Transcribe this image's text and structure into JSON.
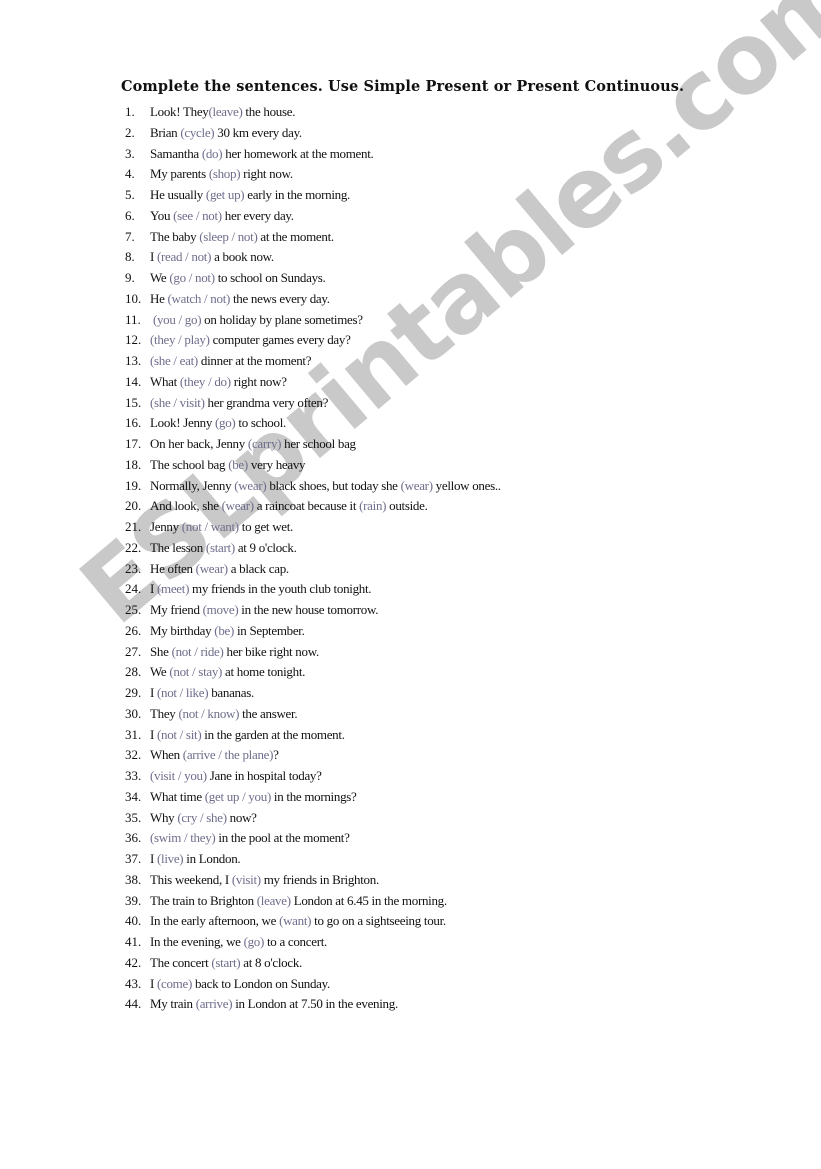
{
  "worksheet": {
    "title": "Complete the sentences. Use Simple Present or Present Continuous.",
    "watermark": "ESLprintables.com",
    "colors": {
      "text": "#111111",
      "hint": "#6e6e8c",
      "watermark": "#c9c9c9"
    },
    "items": [
      {
        "num": "1.",
        "parts": [
          {
            "t": "Look! They"
          },
          {
            "h": "(leave)"
          },
          {
            "t": " the house."
          }
        ]
      },
      {
        "num": "2.",
        "parts": [
          {
            "t": "Brian "
          },
          {
            "h": "(cycle)"
          },
          {
            "t": " 30 km every day."
          }
        ]
      },
      {
        "num": "3.",
        "parts": [
          {
            "t": "Samantha "
          },
          {
            "h": "(do)"
          },
          {
            "t": " her homework at the moment."
          }
        ]
      },
      {
        "num": "4.",
        "parts": [
          {
            "t": "My parents "
          },
          {
            "h": "(shop)"
          },
          {
            "t": " right now."
          }
        ]
      },
      {
        "num": "5.",
        "parts": [
          {
            "t": "He usually "
          },
          {
            "h": "(get up)"
          },
          {
            "t": " early in the morning."
          }
        ]
      },
      {
        "num": "6.",
        "parts": [
          {
            "t": "You "
          },
          {
            "h": "(see / not)"
          },
          {
            "t": " her every day."
          }
        ]
      },
      {
        "num": "7.",
        "parts": [
          {
            "t": "The baby "
          },
          {
            "h": "(sleep / not)"
          },
          {
            "t": " at the moment."
          }
        ]
      },
      {
        "num": "8.",
        "parts": [
          {
            "t": "I "
          },
          {
            "h": "(read / not)"
          },
          {
            "t": " a book now."
          }
        ]
      },
      {
        "num": "9.",
        "parts": [
          {
            "t": "We "
          },
          {
            "h": "(go / not)"
          },
          {
            "t": " to school on Sundays."
          }
        ]
      },
      {
        "num": "10.",
        "parts": [
          {
            "t": "He "
          },
          {
            "h": "(watch / not)"
          },
          {
            "t": " the news every day."
          }
        ]
      },
      {
        "num": "11.",
        "parts": [
          {
            "t": " "
          },
          {
            "h": "(you / go)"
          },
          {
            "t": " on holiday by plane sometimes?"
          }
        ]
      },
      {
        "num": "12.",
        "parts": [
          {
            "h": "(they / play)"
          },
          {
            "t": " computer games every day?"
          }
        ]
      },
      {
        "num": "13.",
        "parts": [
          {
            "h": "(she / eat)"
          },
          {
            "t": " dinner at the moment?"
          }
        ]
      },
      {
        "num": "14.",
        "parts": [
          {
            "t": "What "
          },
          {
            "h": "(they / do)"
          },
          {
            "t": " right now?"
          }
        ]
      },
      {
        "num": "15.",
        "parts": [
          {
            "h": "(she / visit)"
          },
          {
            "t": " her grandma very often?"
          }
        ]
      },
      {
        "num": "16.",
        "parts": [
          {
            "t": "Look! Jenny "
          },
          {
            "h": "(go)"
          },
          {
            "t": " to school."
          }
        ]
      },
      {
        "num": "17.",
        "parts": [
          {
            "t": "On her back, Jenny "
          },
          {
            "h": "(carry)"
          },
          {
            "t": " her school bag"
          }
        ]
      },
      {
        "num": "18.",
        "parts": [
          {
            "t": "The school bag "
          },
          {
            "h": "(be)"
          },
          {
            "t": " very heavy"
          }
        ]
      },
      {
        "num": "19.",
        "parts": [
          {
            "t": "Normally, Jenny "
          },
          {
            "h": "(wear)"
          },
          {
            "t": " black shoes, but today she "
          },
          {
            "h": "(wear)"
          },
          {
            "t": " yellow ones.."
          }
        ]
      },
      {
        "num": "20.",
        "parts": [
          {
            "t": "And look, she "
          },
          {
            "h": "(wear)"
          },
          {
            "t": " a raincoat because it "
          },
          {
            "h": "(rain)"
          },
          {
            "t": " outside."
          }
        ]
      },
      {
        "num": "21.",
        "parts": [
          {
            "t": "Jenny "
          },
          {
            "h": "(not / want)"
          },
          {
            "t": " to get wet."
          }
        ]
      },
      {
        "num": "22.",
        "parts": [
          {
            "t": "The lesson "
          },
          {
            "h": "(start)"
          },
          {
            "t": " at 9 o'clock."
          }
        ]
      },
      {
        "num": "23.",
        "parts": [
          {
            "t": "He often "
          },
          {
            "h": "(wear)"
          },
          {
            "t": " a black cap."
          }
        ]
      },
      {
        "num": "24.",
        "parts": [
          {
            "t": "I "
          },
          {
            "h": "(meet)"
          },
          {
            "t": " my friends in the youth club tonight."
          }
        ]
      },
      {
        "num": "25.",
        "parts": [
          {
            "t": "My friend "
          },
          {
            "h": "(move)"
          },
          {
            "t": " in the new house tomorrow."
          }
        ]
      },
      {
        "num": "26.",
        "parts": [
          {
            "t": "My birthday "
          },
          {
            "h": "(be)"
          },
          {
            "t": " in September."
          }
        ]
      },
      {
        "num": "27.",
        "parts": [
          {
            "t": "She "
          },
          {
            "h": "(not / ride)"
          },
          {
            "t": " her bike right now."
          }
        ]
      },
      {
        "num": "28.",
        "parts": [
          {
            "t": "We "
          },
          {
            "h": "(not / stay)"
          },
          {
            "t": " at home tonight."
          }
        ]
      },
      {
        "num": "29.",
        "parts": [
          {
            "t": "I "
          },
          {
            "h": "(not / like)"
          },
          {
            "t": " bananas."
          }
        ]
      },
      {
        "num": "30.",
        "parts": [
          {
            "t": "They "
          },
          {
            "h": "(not / know)"
          },
          {
            "t": " the answer."
          }
        ]
      },
      {
        "num": "31.",
        "parts": [
          {
            "t": "I "
          },
          {
            "h": "(not / sit)"
          },
          {
            "t": " in the garden at the moment."
          }
        ]
      },
      {
        "num": "32.",
        "parts": [
          {
            "t": "When "
          },
          {
            "h": "(arrive / the plane)"
          },
          {
            "t": "?"
          }
        ]
      },
      {
        "num": "33.",
        "parts": [
          {
            "h": "(visit / you)"
          },
          {
            "t": " Jane in hospital today?"
          }
        ]
      },
      {
        "num": "34.",
        "parts": [
          {
            "t": "What time "
          },
          {
            "h": "(get up / you)"
          },
          {
            "t": " in the mornings?"
          }
        ]
      },
      {
        "num": "35.",
        "parts": [
          {
            "t": "Why "
          },
          {
            "h": "(cry / she)"
          },
          {
            "t": " now?"
          }
        ]
      },
      {
        "num": "36.",
        "parts": [
          {
            "h": "(swim / they)"
          },
          {
            "t": " in the pool at the moment?"
          }
        ]
      },
      {
        "num": "37.",
        "parts": [
          {
            "t": "I "
          },
          {
            "h": "(live)"
          },
          {
            "t": " in London."
          }
        ]
      },
      {
        "num": "38.",
        "parts": [
          {
            "t": "This weekend, I "
          },
          {
            "h": "(visit)"
          },
          {
            "t": " my friends in Brighton."
          }
        ]
      },
      {
        "num": "39.",
        "parts": [
          {
            "t": "The train to Brighton "
          },
          {
            "h": "(leave)"
          },
          {
            "t": " London at 6.45 in the morning."
          }
        ]
      },
      {
        "num": "40.",
        "parts": [
          {
            "t": "In the early afternoon, we "
          },
          {
            "h": "(want)"
          },
          {
            "t": " to go on a sightseeing tour."
          }
        ]
      },
      {
        "num": "41.",
        "parts": [
          {
            "t": "In the evening, we "
          },
          {
            "h": "(go)"
          },
          {
            "t": " to a concert."
          }
        ]
      },
      {
        "num": "42.",
        "parts": [
          {
            "t": "The concert "
          },
          {
            "h": "(start)"
          },
          {
            "t": " at 8 o'clock."
          }
        ]
      },
      {
        "num": "43.",
        "parts": [
          {
            "t": "I "
          },
          {
            "h": "(come)"
          },
          {
            "t": " back to London on Sunday."
          }
        ]
      },
      {
        "num": "44.",
        "parts": [
          {
            "t": "My train "
          },
          {
            "h": "(arrive)"
          },
          {
            "t": " in London at 7.50 in the evening."
          }
        ]
      }
    ]
  }
}
